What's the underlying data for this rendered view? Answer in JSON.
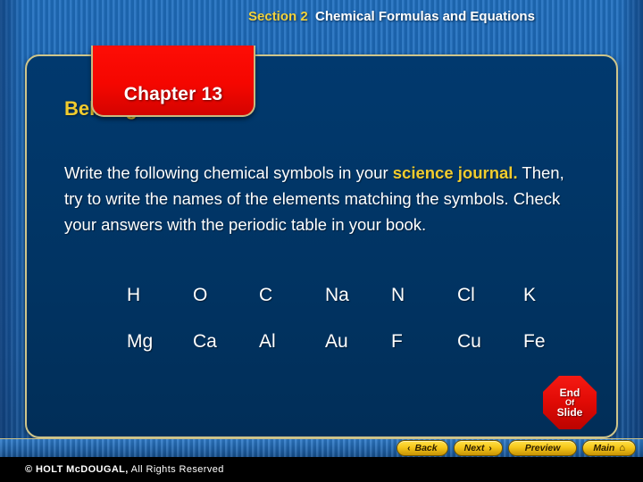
{
  "header": {
    "chapter_label": "Chapter 13",
    "section_number": "Section 2",
    "section_title": "Chemical Formulas and Equations"
  },
  "slide": {
    "heading": "Bellringer",
    "body_part1": "Write the following chemical symbols in your ",
    "body_highlight": "science journal.",
    "body_part2": " Then, try to write the names of the elements matching the symbols. Check your answers with the periodic table in your book.",
    "symbol_rows": [
      [
        "H",
        "O",
        "C",
        "Na",
        "N",
        "Cl",
        "K"
      ],
      [
        "Mg",
        "Ca",
        "Al",
        "Au",
        "F",
        "Cu",
        "Fe"
      ]
    ]
  },
  "end_badge": {
    "line1": "End",
    "line2": "Of",
    "line3": "Slide"
  },
  "nav": {
    "back_chevron": "‹",
    "back_label": "Back",
    "next_label": "Next",
    "next_chevron": "›",
    "preview_label": "Preview",
    "main_label": "Main",
    "main_icon": "⌂"
  },
  "footer": {
    "copyright_mark": "© HOLT McDOUGAL,",
    "copyright_rest": " All Rights Reserved"
  },
  "colors": {
    "panel_navy": "#013463",
    "accent_gold": "#f2cc2e",
    "chapter_red": "#f50600",
    "border_tan": "#cfc58a",
    "button_gold": "#f6c71a"
  }
}
